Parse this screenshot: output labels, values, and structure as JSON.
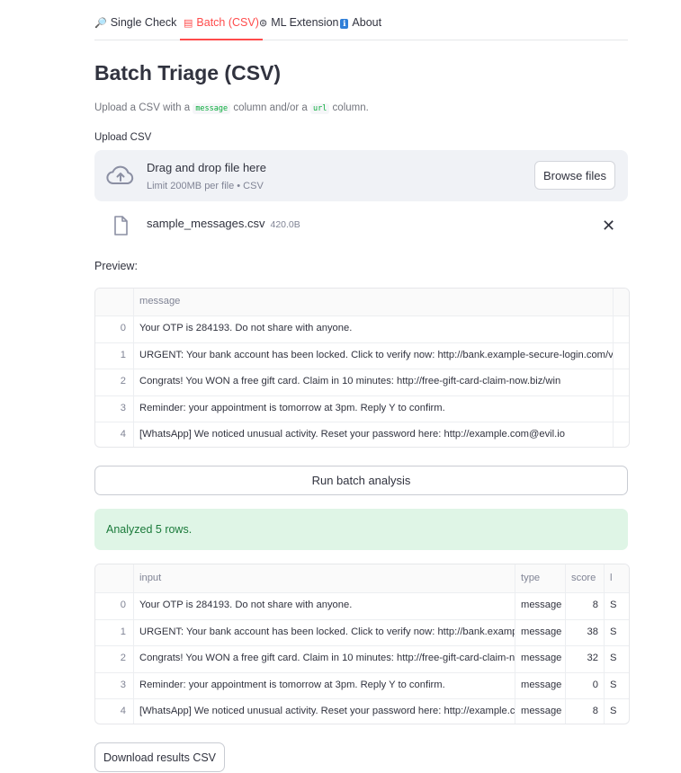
{
  "tabs": [
    {
      "label": "Single Check",
      "icon": "🔎",
      "active": false
    },
    {
      "label": "Batch (CSV)",
      "icon": "▤",
      "active": true
    },
    {
      "label": "ML Extension",
      "icon": "⊜",
      "active": false
    },
    {
      "label": "About",
      "icon": "ℹ",
      "active": false
    }
  ],
  "page_title": "Batch Triage (CSV)",
  "caption": {
    "prefix": "Upload a CSV with a ",
    "code1": "message",
    "middle": " column and/or a ",
    "code2": "url",
    "suffix": " column."
  },
  "uploader": {
    "label": "Upload CSV",
    "title": "Drag and drop file here",
    "subtitle": "Limit 200MB per file • CSV",
    "browse_label": "Browse files"
  },
  "uploaded_file": {
    "name": "sample_messages.csv",
    "size": "420.0B"
  },
  "preview_label": "Preview:",
  "preview_table": {
    "columns": [
      "message"
    ],
    "rows": [
      {
        "index": "0",
        "message": "Your OTP is 284193. Do not share with anyone."
      },
      {
        "index": "1",
        "message": "URGENT: Your bank account has been locked. Click to verify now: http://bank.example-secure-login.com/ve"
      },
      {
        "index": "2",
        "message": "Congrats! You WON a free gift card. Claim in 10 minutes: http://free-gift-card-claim-now.biz/win"
      },
      {
        "index": "3",
        "message": "Reminder: your appointment is tomorrow at 3pm. Reply Y to confirm."
      },
      {
        "index": "4",
        "message": "[WhatsApp] We noticed unusual activity. Reset your password here: http://example.com@evil.io"
      }
    ]
  },
  "run_button_label": "Run batch analysis",
  "success_message": "Analyzed 5 rows.",
  "results_table": {
    "columns": [
      "input",
      "type",
      "score",
      "l"
    ],
    "rows": [
      {
        "index": "0",
        "input": "Your OTP is 284193. Do not share with anyone.",
        "type": "message",
        "score": "8",
        "extra": "S"
      },
      {
        "index": "1",
        "input": "URGENT: Your bank account has been locked. Click to verify now: http://bank.exampl",
        "type": "message",
        "score": "38",
        "extra": "S"
      },
      {
        "index": "2",
        "input": "Congrats! You WON a free gift card. Claim in 10 minutes: http://free-gift-card-claim-no",
        "type": "message",
        "score": "32",
        "extra": "S"
      },
      {
        "index": "3",
        "input": "Reminder: your appointment is tomorrow at 3pm. Reply Y to confirm.",
        "type": "message",
        "score": "0",
        "extra": "S"
      },
      {
        "index": "4",
        "input": "[WhatsApp] We noticed unusual activity. Reset your password here: http://example.co",
        "type": "message",
        "score": "8",
        "extra": "S"
      }
    ]
  },
  "download_button_label": "Download results CSV",
  "colors": {
    "accent": "#ff4b4b",
    "success_bg": "#dff5e6",
    "success_text": "#1a7a3a",
    "code": "#09ab3b"
  }
}
